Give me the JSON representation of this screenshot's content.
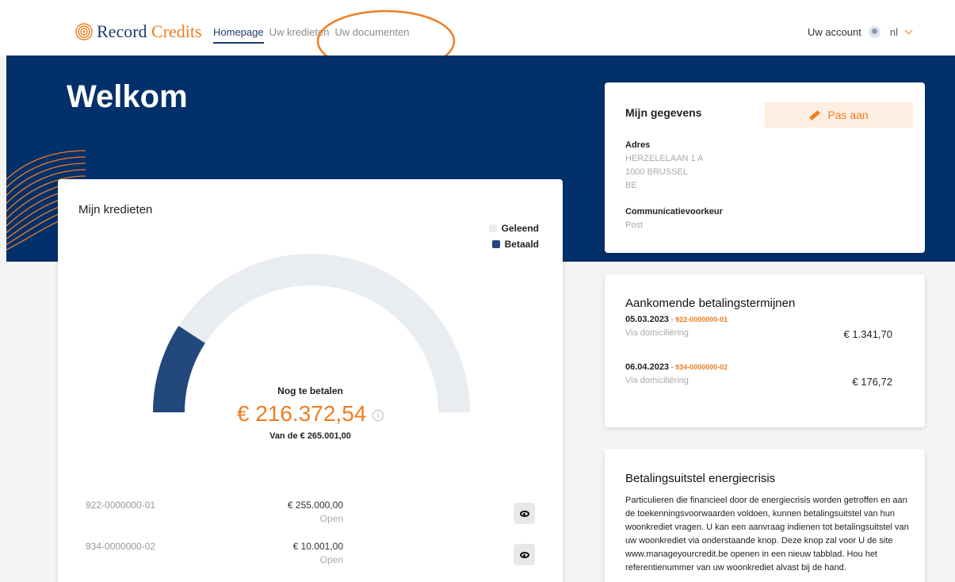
{
  "header": {
    "logo_text_a": "Record",
    "logo_text_b": "Credits",
    "nav": [
      {
        "label": "Homepage",
        "active": true
      },
      {
        "label": "Uw kredieten",
        "active": false
      },
      {
        "label": "Uw documenten",
        "active": false
      }
    ],
    "account_label": "Uw account",
    "language": "nl",
    "highlight_color": "#ef7d22"
  },
  "hero": {
    "title": "Welkom",
    "background": "#02306a"
  },
  "credits_card": {
    "title": "Mijn kredieten",
    "legend": [
      {
        "label": "Geleend",
        "color": "#e9ecf1"
      },
      {
        "label": "Betaald",
        "color": "#23487c"
      }
    ],
    "gauge_label": "Nog te betalen",
    "remaining_amount": "€ 216.372,54",
    "total_label": "Van de € 265.001,00",
    "loans": [
      {
        "number": "922-0000000-01",
        "amount": "€ 255.000,00",
        "status": "Open"
      },
      {
        "number": "934-0000000-02",
        "amount": "€ 10.001,00",
        "status": "Open"
      }
    ]
  },
  "chart_data": {
    "type": "gauge",
    "title": "Mijn kredieten",
    "series": [
      {
        "name": "Geleend",
        "value": 265001.0
      },
      {
        "name": "Betaald",
        "value": 48628.46
      }
    ],
    "remaining": 216372.54,
    "total": 265001.0
  },
  "details_card": {
    "title": "Mijn gegevens",
    "edit_label": "Pas aan",
    "address_label": "Adres",
    "address_line1": "HERZELELAAN 1 A",
    "address_line2": "1000 BRUSSEL",
    "address_line3": "BE",
    "comm_label": "Communicatievoorkeur",
    "comm_value": "Post"
  },
  "upcoming_card": {
    "title": "Aankomende betalingstermijnen",
    "payments": [
      {
        "date": "05.03.2023",
        "ref": "922-0000000-01",
        "method": "Via domiciliëring",
        "amount": "€ 1.341,70"
      },
      {
        "date": "06.04.2023",
        "ref": "934-0000000-02",
        "method": "Via domiciliëring",
        "amount": "€ 176,72"
      }
    ]
  },
  "energy_card": {
    "title": "Betalingsuitstel energiecrisis",
    "body": "Particulieren die financieel door de energiecrisis worden getroffen en aan de toekenningsvoorwaarden voldoen, kunnen betalingsuitstel van hun woonkrediet vragen. U kan een aanvraag indienen tot betalingsuitstel van uw woonkrediet via onderstaande knop. Deze knop zal voor U de site www.manageyourcredit.be openen in een nieuw tabblad. Hou het referentienummer van uw woonkrediet alvast bij de hand."
  }
}
